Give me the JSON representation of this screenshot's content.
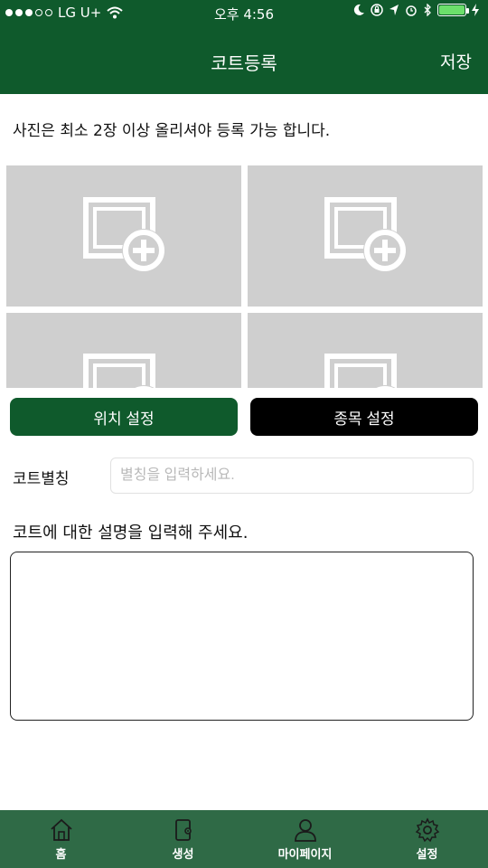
{
  "status_bar": {
    "carrier": "LG U+",
    "time": "오후 4:56"
  },
  "header": {
    "title": "코트등록",
    "save": "저장"
  },
  "notice": "사진은 최소 2장 이상 올리셔야 등록 가능 합니다.",
  "photos": {
    "add_icon": "add-photo-icon",
    "count": 4
  },
  "buttons": {
    "location": "위치 설정",
    "sport": "종목 설정"
  },
  "nickname": {
    "label": "코트별칭",
    "placeholder": "별칭을 입력하세요."
  },
  "description": {
    "label": "코트에 대한 설명을 입력해 주세요.",
    "value": ""
  },
  "tabs": [
    {
      "label": "홈",
      "icon": "home-icon"
    },
    {
      "label": "생성",
      "icon": "create-icon"
    },
    {
      "label": "마이페이지",
      "icon": "mypage-icon"
    },
    {
      "label": "설정",
      "icon": "settings-icon"
    }
  ],
  "colors": {
    "primary": "#0f5a2c",
    "tabbar": "#2f6a46",
    "photo_bg": "#cfcfcf",
    "dark_button": "#000000"
  }
}
